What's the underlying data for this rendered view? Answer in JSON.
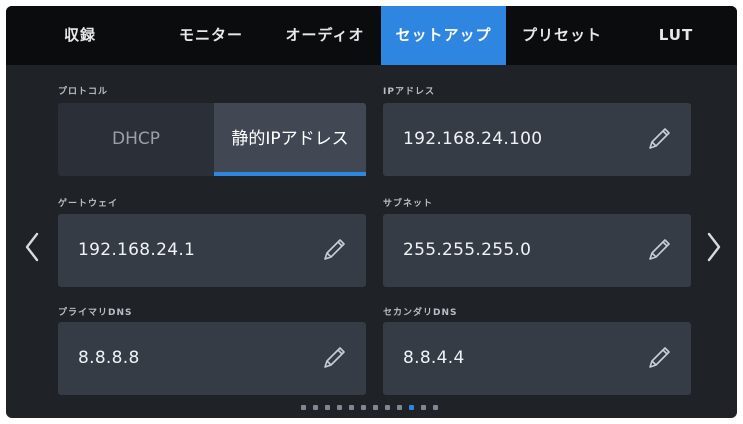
{
  "tabs": [
    {
      "label": "収録",
      "active": false
    },
    {
      "label": "モニター",
      "active": false
    },
    {
      "label": "オーディオ",
      "active": false
    },
    {
      "label": "セットアップ",
      "active": true
    },
    {
      "label": "プリセット",
      "active": false
    },
    {
      "label": "LUT",
      "active": false
    }
  ],
  "protocol": {
    "label": "プロトコル",
    "options": [
      "DHCP",
      "静的IPアドレス"
    ],
    "selected": "静的IPアドレス"
  },
  "ip_address": {
    "label": "IPアドレス",
    "value": "192.168.24.100"
  },
  "gateway": {
    "label": "ゲートウェイ",
    "value": "192.168.24.1"
  },
  "subnet": {
    "label": "サブネット",
    "value": "255.255.255.0"
  },
  "primary_dns": {
    "label": "プライマリDNS",
    "value": "8.8.8.8"
  },
  "secondary_dns": {
    "label": "セカンダリDNS",
    "value": "8.8.4.4"
  },
  "pagination": {
    "page_count": 12,
    "current_page": 10
  },
  "icons": {
    "edit": "pencil-icon",
    "prev": "chevron-left-icon",
    "next": "chevron-right-icon"
  },
  "colors": {
    "accent": "#2f86e0",
    "background": "#1f2227",
    "field": "#363c46",
    "tabbar": "#0b0c0e"
  }
}
